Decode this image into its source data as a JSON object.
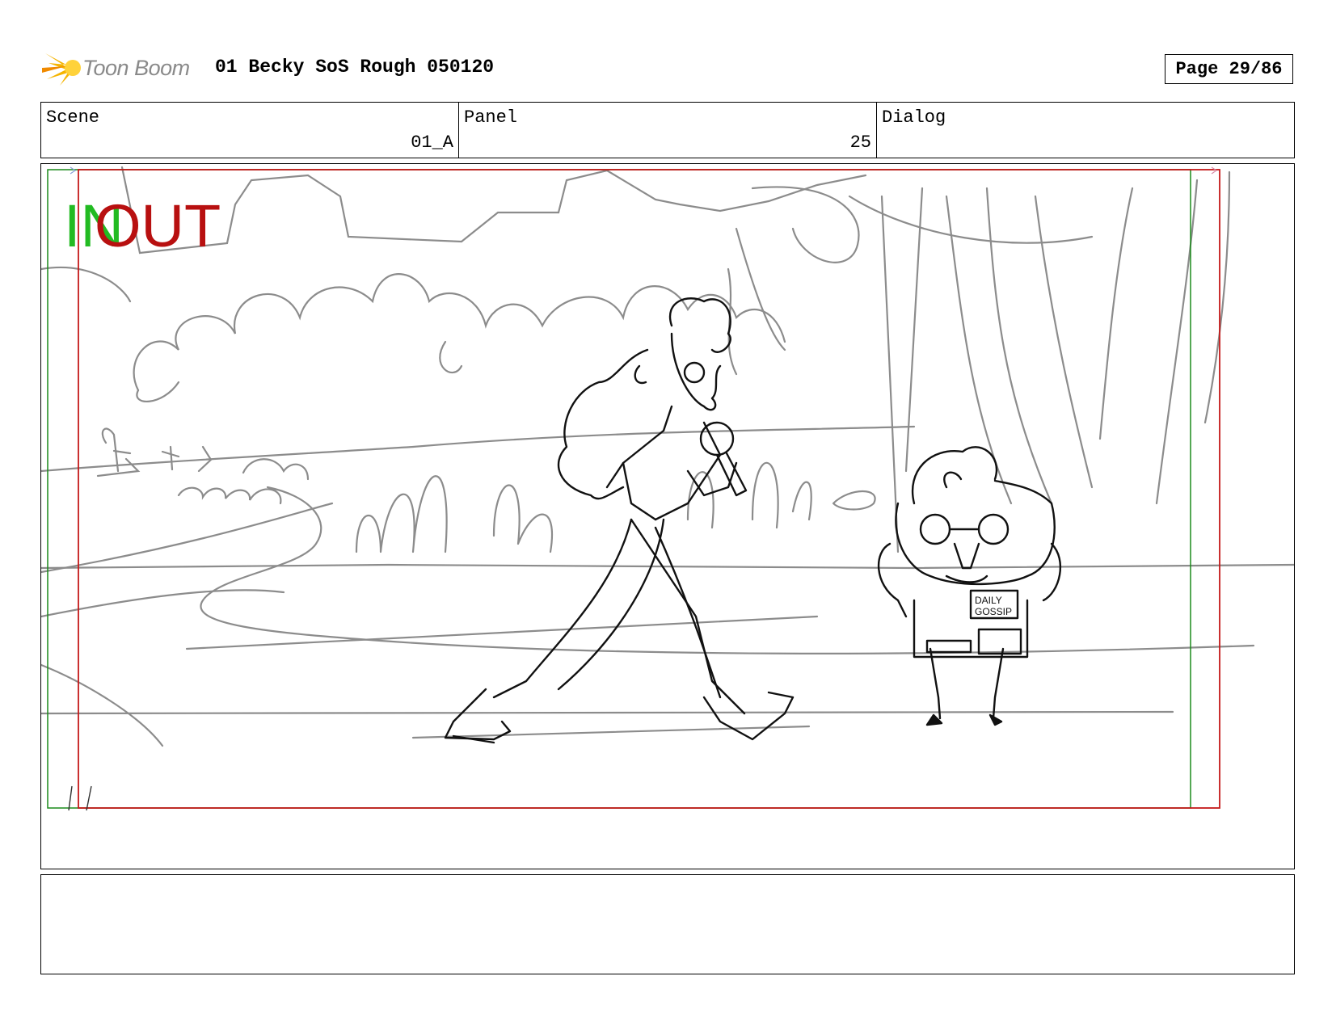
{
  "header": {
    "logo_text": "Toon Boom",
    "title": "01 Becky SoS Rough 050120",
    "page_label": "Page 29/86"
  },
  "info": {
    "scene_label": "Scene",
    "scene_value": "01_A",
    "panel_label": "Panel",
    "panel_value": "25",
    "dialog_label": "Dialog",
    "dialog_value": ""
  },
  "panel": {
    "in_label": "IN",
    "out_label": "OUT",
    "sign_text_1": "DAILY",
    "sign_text_2": "GOSSIP"
  },
  "notes": {
    "text": ""
  },
  "colors": {
    "in_frame": "#1a8a1a",
    "out_frame": "#c41a1a",
    "logo_flare": "#f5b400"
  }
}
